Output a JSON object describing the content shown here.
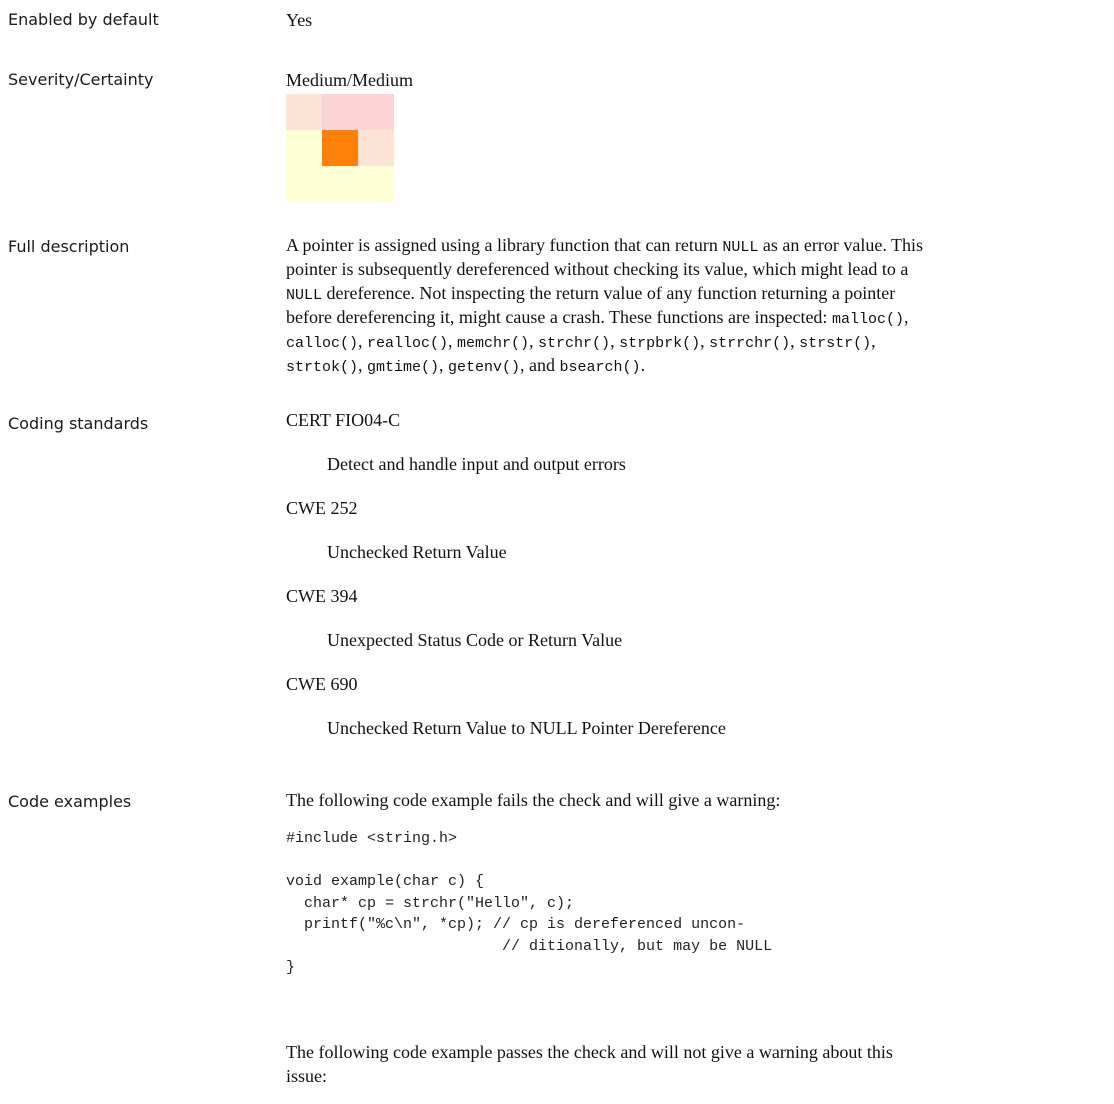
{
  "enabled": {
    "label": "Enabled by default",
    "value": "Yes"
  },
  "severity": {
    "label": "Severity/Certainty",
    "value": "Medium/Medium",
    "grid_colors": [
      "#fde2d6",
      "#fdd4d6",
      "#fdd4d6",
      "#ffffd5",
      "#fe8009",
      "#fde2d6",
      "#ffffd5",
      "#ffffd5",
      "#ffffd5"
    ]
  },
  "description": {
    "label": "Full description",
    "line1_text": "A pointer is assigned using a library function that can return ",
    "line1_code": "NULL",
    "line1_text2": " as an error value. This",
    "line2": "pointer is subsequently dereferenced without checking its value, which might lead to a",
    "line3_code": "NULL",
    "line3_text": " dereference. Not inspecting the return value of any function returning a pointer",
    "line4": "before dereferencing it, might cause a crash.  These functions are inspected: ",
    "functions": [
      "malloc()",
      "calloc()",
      "realloc()",
      "memchr()",
      "strchr()",
      "strpbrk()",
      "strrchr()",
      "strstr()",
      "strtok()",
      "gmtime()",
      "getenv()",
      "bsearch()"
    ],
    "and_word": "and",
    "period": "."
  },
  "coding_standards": {
    "label": "Coding standards",
    "items": [
      {
        "name": "CERT FIO04-C",
        "desc": "Detect and handle input and output errors"
      },
      {
        "name": "CWE 252",
        "desc": "Unchecked Return Value"
      },
      {
        "name": "CWE 394",
        "desc": "Unexpected Status Code or Return Value"
      },
      {
        "name": "CWE 690",
        "desc": "Unchecked Return Value to NULL Pointer Dereference"
      }
    ]
  },
  "code_examples": {
    "label": "Code examples",
    "intro_fail": "The following code example fails the check and will give a warning:",
    "code_fail": "#include <string.h>\n\nvoid example(char c) {\n  char* cp = strchr(\"Hello\", c);\n  printf(\"%c\\n\", *cp); // cp is dereferenced uncon-\n                        // ditionally, but may be NULL\n}",
    "intro_pass_line1": "The following code example passes the check and will not give a warning about this",
    "intro_pass_line2": "issue:"
  }
}
